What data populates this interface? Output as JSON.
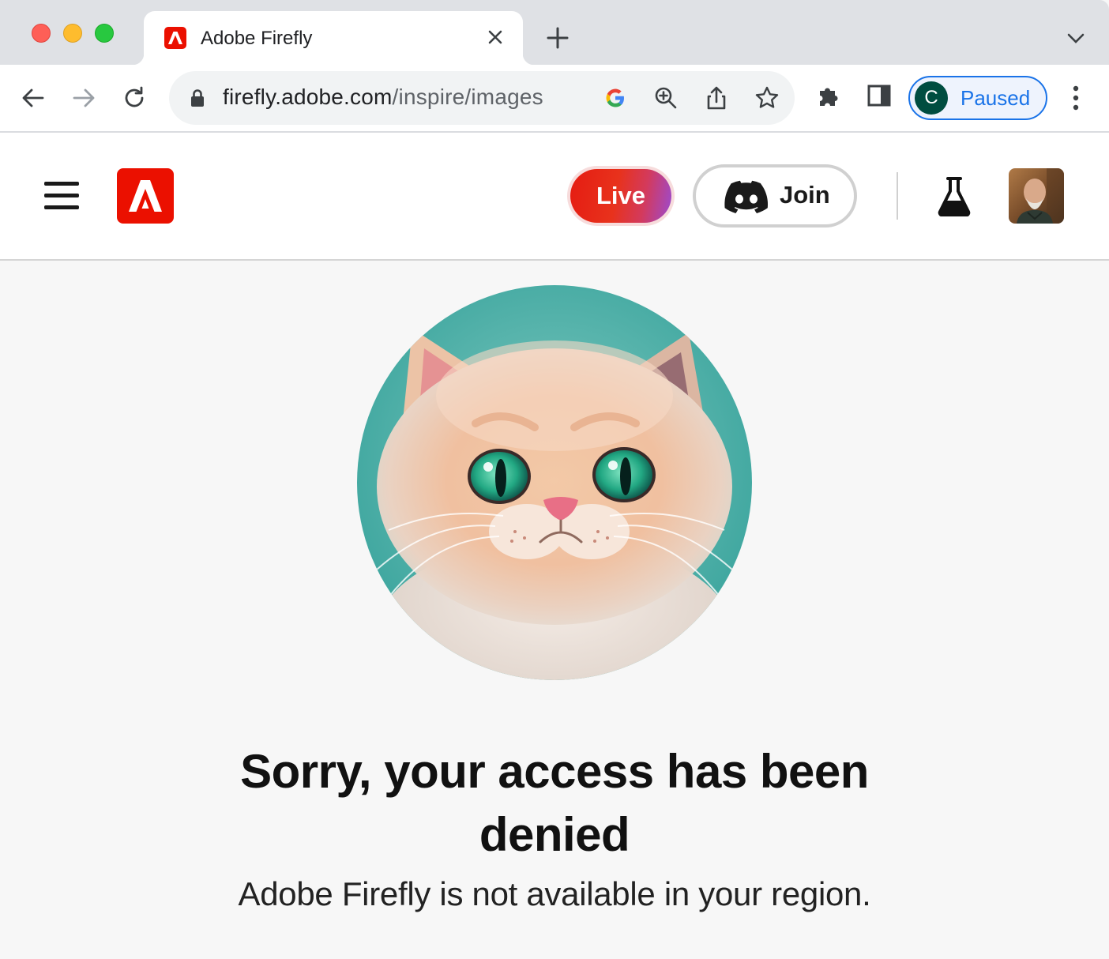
{
  "browser": {
    "tab": {
      "title": "Adobe Firefly"
    },
    "address": {
      "host": "firefly.adobe.com",
      "path": "/inspire/images"
    },
    "profile": {
      "initial": "C",
      "status": "Paused"
    }
  },
  "header": {
    "live_label": "Live",
    "join_label": "Join"
  },
  "main": {
    "heading": "Sorry, your access has been denied",
    "message": "Adobe Firefly is not available in your region."
  },
  "colors": {
    "adobe_red": "#eb1000",
    "chrome_blue": "#1a73e8",
    "page_background": "#f7f7f7"
  }
}
